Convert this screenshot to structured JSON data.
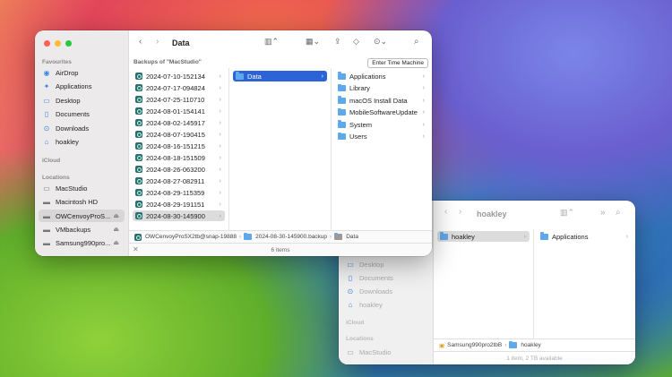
{
  "front": {
    "title": "Data",
    "backups_header": "Backups of \"MacStudio\"",
    "enter_tm": "Enter Time Machine",
    "sidebar": {
      "favourites": "Favourites",
      "fav_items": [
        "AirDrop",
        "Applications",
        "Desktop",
        "Documents",
        "Downloads",
        "hoakley"
      ],
      "icloud": "iCloud",
      "locations": "Locations",
      "loc_items": [
        "MacStudio",
        "Macintosh HD",
        "OWCenvoyProS...",
        "VMbackups",
        "Samsung990pro..."
      ]
    },
    "backups": [
      "2024-07-10-152134",
      "2024-07-17-094824",
      "2024-07-25-110710",
      "2024-08-01-154141",
      "2024-08-02-145917",
      "2024-08-07-190415",
      "2024-08-16-151215",
      "2024-08-18-151509",
      "2024-08-26-063200",
      "2024-08-27-082911",
      "2024-08-29-115359",
      "2024-08-29-191151",
      "2024-08-30-145900"
    ],
    "col2": [
      "Data"
    ],
    "col3": [
      "Applications",
      "Library",
      "macOS Install Data",
      "MobileSoftwareUpdate",
      "System",
      "Users"
    ],
    "path": [
      "OWCenvoyProSX2tb@snap-19888",
      "2024-08-30-145900.backup",
      "Data"
    ],
    "status": "6 items"
  },
  "back": {
    "title": "hoakley",
    "sidebar_items": [
      "Desktop",
      "Documents",
      "Downloads",
      "hoakley"
    ],
    "icloud": "iCloud",
    "locations": "Locations",
    "loc_items": [
      "MacStudio"
    ],
    "col1": [
      "hoakley"
    ],
    "col2": [
      "Applications"
    ],
    "path": [
      "Samsung990pro2tbB",
      "hoakley"
    ],
    "status": "1 item, 2 TB available"
  }
}
